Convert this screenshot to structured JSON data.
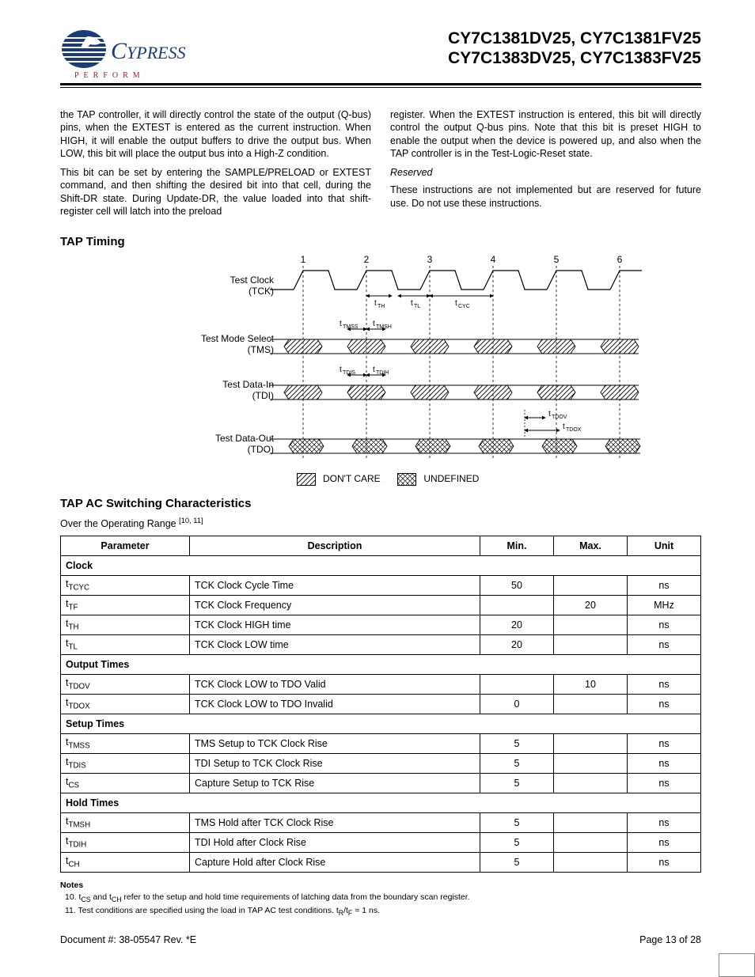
{
  "header": {
    "logo_name": "CYPRESS",
    "logo_tag": "PERFORM",
    "parts_line1": "CY7C1381DV25, CY7C1381FV25",
    "parts_line2": "CY7C1383DV25, CY7C1383FV25"
  },
  "body": {
    "left_p1": "the TAP controller, it will directly control the state of the output (Q-bus) pins, when the EXTEST is entered as the current instruction. When HIGH, it will enable the output buffers to drive the output bus. When LOW, this bit will place the output bus into a High-Z condition.",
    "left_p2": "This bit can be set by entering the SAMPLE/PRELOAD or EXTEST command, and then shifting the desired bit into that cell, during the Shift-DR state. During Update-DR, the value loaded into that shift-register cell will latch into the preload",
    "right_p1": "register. When the EXTEST instruction is entered, this bit will directly control the output Q-bus pins. Note that this bit is preset HIGH to enable the output when the device is powered up, and also when the TAP controller is in the Test-Logic-Reset state.",
    "reserved_hd": "Reserved",
    "right_p2": "These instructions are not implemented but are reserved for future use. Do not use these instructions."
  },
  "sec1_title": "TAP Timing",
  "chart_data": {
    "type": "timing-diagram",
    "cycles": [
      1,
      2,
      3,
      4,
      5,
      6
    ],
    "signals": [
      {
        "name": "Test Clock",
        "sub": "(TCK)",
        "kind": "clock"
      },
      {
        "name": "Test Mode Select",
        "sub": "(TMS)",
        "kind": "data",
        "annotations": [
          "tTMSS",
          "tTMSH"
        ]
      },
      {
        "name": "Test Data-In",
        "sub": "(TDI)",
        "kind": "data",
        "annotations": [
          "tTDIS",
          "tTDIH"
        ]
      },
      {
        "name": "Test Data-Out",
        "sub": "(TDO)",
        "kind": "data",
        "annotations": [
          "tTDOV",
          "tTDOX"
        ]
      }
    ],
    "clock_annotations": [
      "tTH",
      "tTL",
      "tCYC"
    ],
    "legend": [
      {
        "pattern": "hatch",
        "label": "DON'T CARE"
      },
      {
        "pattern": "cross",
        "label": "UNDEFINED"
      }
    ]
  },
  "sec2_title": "TAP AC Switching Characteristics",
  "sec2_sub_prefix": "Over the Operating Range ",
  "sec2_sub_refs": "[10, 11]",
  "table": {
    "headers": [
      "Parameter",
      "Description",
      "Min.",
      "Max.",
      "Unit"
    ],
    "groups": [
      {
        "title": "Clock",
        "rows": [
          {
            "p": "t",
            "ps": "TCYC",
            "d": "TCK Clock Cycle Time",
            "min": "50",
            "max": "",
            "u": "ns"
          },
          {
            "p": "t",
            "ps": "TF",
            "d": "TCK Clock Frequency",
            "min": "",
            "max": "20",
            "u": "MHz"
          },
          {
            "p": "t",
            "ps": "TH",
            "d": "TCK Clock HIGH time",
            "min": "20",
            "max": "",
            "u": "ns"
          },
          {
            "p": "t",
            "ps": "TL",
            "d": "TCK Clock LOW time",
            "min": "20",
            "max": "",
            "u": "ns"
          }
        ]
      },
      {
        "title": "Output Times",
        "rows": [
          {
            "p": "t",
            "ps": "TDOV",
            "d": "TCK Clock LOW to TDO Valid",
            "min": "",
            "max": "10",
            "u": "ns"
          },
          {
            "p": "t",
            "ps": "TDOX",
            "d": "TCK Clock LOW to TDO Invalid",
            "min": "0",
            "max": "",
            "u": "ns"
          }
        ]
      },
      {
        "title": "Setup Times",
        "rows": [
          {
            "p": "t",
            "ps": "TMSS",
            "d": "TMS Setup to TCK Clock Rise",
            "min": "5",
            "max": "",
            "u": "ns"
          },
          {
            "p": "t",
            "ps": "TDIS",
            "d": "TDI Setup to TCK Clock Rise",
            "min": "5",
            "max": "",
            "u": "ns"
          },
          {
            "p": "t",
            "ps": "CS",
            "d": "Capture Setup to TCK Rise",
            "min": "5",
            "max": "",
            "u": "ns"
          }
        ]
      },
      {
        "title": "Hold Times",
        "rows": [
          {
            "p": "t",
            "ps": "TMSH",
            "d": "TMS Hold after TCK Clock Rise",
            "min": "5",
            "max": "",
            "u": "ns"
          },
          {
            "p": "t",
            "ps": "TDIH",
            "d": "TDI Hold after Clock Rise",
            "min": "5",
            "max": "",
            "u": "ns"
          },
          {
            "p": "t",
            "ps": "CH",
            "d": "Capture Hold after Clock Rise",
            "min": "5",
            "max": "",
            "u": "ns"
          }
        ]
      }
    ]
  },
  "notes_hd": "Notes",
  "notes": [
    "10. t_CS and t_CH refer to the setup and hold time requirements of latching data from the boundary scan register.",
    "11. Test conditions are specified using the load in TAP AC test conditions. t_R/t_F = 1 ns."
  ],
  "footer": {
    "doc": "Document #: 38-05547 Rev. *E",
    "page": "Page 13 of 28"
  }
}
